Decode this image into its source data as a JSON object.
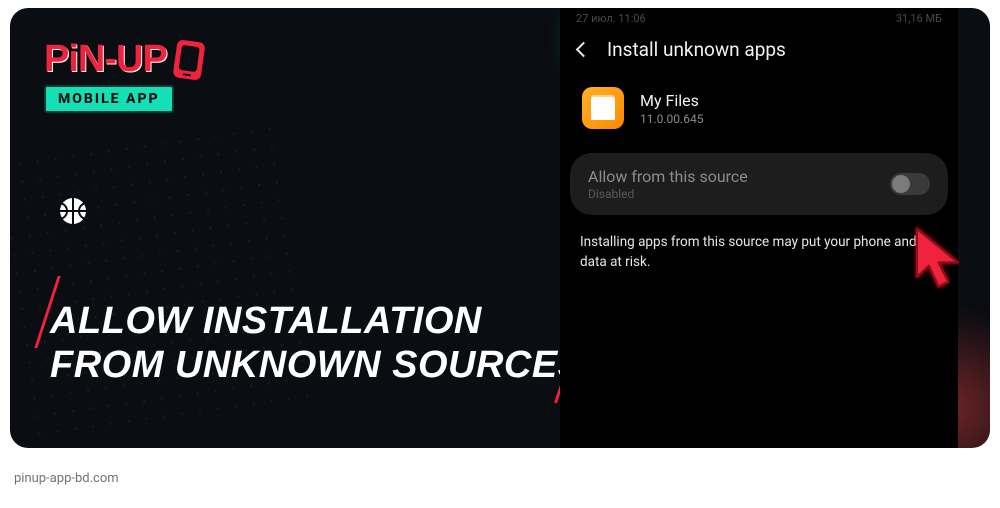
{
  "logo": {
    "brand": "PiN-UP",
    "tagline": "MOBILE APP"
  },
  "headline": {
    "line1": "ALLOW INSTALLATION",
    "line2": "FROM UNKNOWN SOURCES"
  },
  "phone": {
    "status": {
      "date": "27 июл. 11:06",
      "size": "31,16 МБ"
    },
    "title": "Install unknown apps",
    "app": {
      "name": "My Files",
      "version": "11.0.00.645"
    },
    "toggle": {
      "label": "Allow from this source",
      "state": "Disabled",
      "enabled": false
    },
    "warning": "Installing apps from this source may put your phone and data at risk."
  },
  "footer": "pinup-app-bd.com",
  "colors": {
    "accent_red": "#ef233c",
    "accent_teal": "#14e0b8"
  }
}
